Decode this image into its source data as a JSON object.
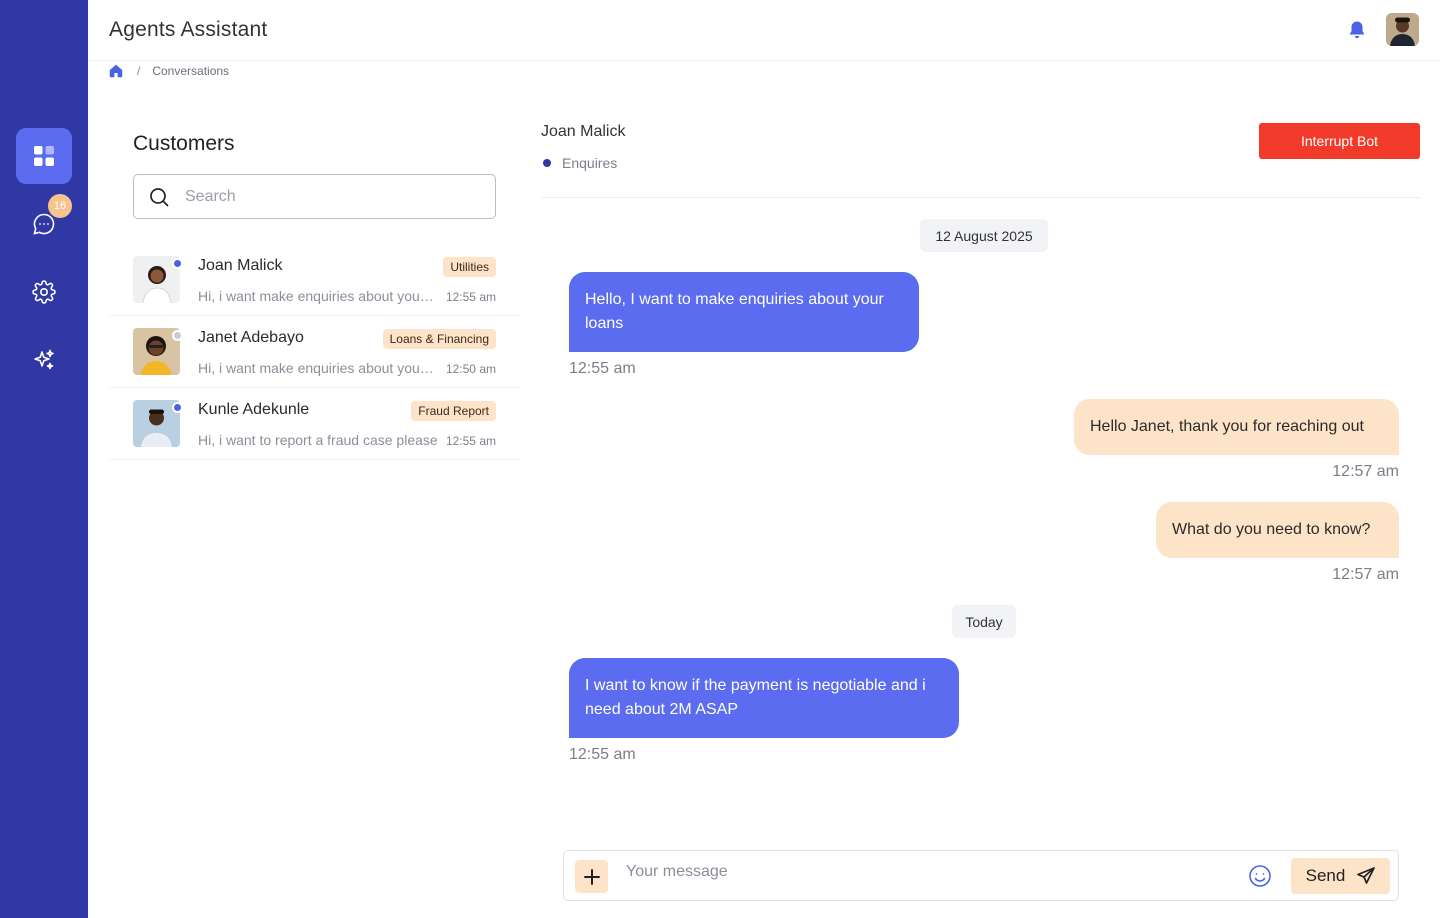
{
  "app": {
    "title": "Agents Assistant"
  },
  "sidebar": {
    "items": [
      {
        "name": "dashboard",
        "icon": "dashboard-icon",
        "active": true
      },
      {
        "name": "conversations",
        "icon": "chat-icon",
        "badge": "16"
      },
      {
        "name": "settings",
        "icon": "gear-icon"
      },
      {
        "name": "ai",
        "icon": "sparkles-icon"
      }
    ]
  },
  "header": {
    "notification_icon": "bell-icon",
    "avatar": "user-avatar"
  },
  "breadcrumb": {
    "home_icon": "home-icon",
    "separator": "/",
    "current": "Conversations"
  },
  "customers": {
    "title": "Customers",
    "search_placeholder": "Search",
    "list": [
      {
        "name": "Joan Malick",
        "tag": "Utilities",
        "preview": "Hi, i want make enquiries about your loans",
        "time": "12:55 am",
        "online": true
      },
      {
        "name": "Janet Adebayo",
        "tag": "Loans & Financing",
        "preview": "Hi, i want make enquiries about your loans",
        "time": "12:50 am",
        "online": false
      },
      {
        "name": "Kunle Adekunle",
        "tag": "Fraud Report",
        "preview": "Hi, i want to report a fraud case please",
        "time": "12:55 am",
        "online": true
      }
    ]
  },
  "chat": {
    "name": "Joan Malick",
    "status": "Enquires",
    "interrupt_label": "Interrupt Bot",
    "date_1": "12 August 2025",
    "date_2": "Today",
    "messages": [
      {
        "text": "Hello, I want to make enquiries about your loans",
        "time": "12:55 am",
        "direction": "in"
      },
      {
        "text": "Hello Janet, thank you for reaching out",
        "time": "12:57 am",
        "direction": "out"
      },
      {
        "text": "What do you need to know?",
        "time": "12:57 am",
        "direction": "out"
      },
      {
        "text": "I want to know if the payment is negotiable and i need about 2M ASAP",
        "time": "12:55 am",
        "direction": "in"
      }
    ],
    "composer": {
      "placeholder": "Your message",
      "send_label": "Send"
    }
  },
  "colors": {
    "sidebar": "#3038a6",
    "primary": "#5b6cf0",
    "accent": "#fde3c8",
    "danger": "#f23a2b"
  }
}
